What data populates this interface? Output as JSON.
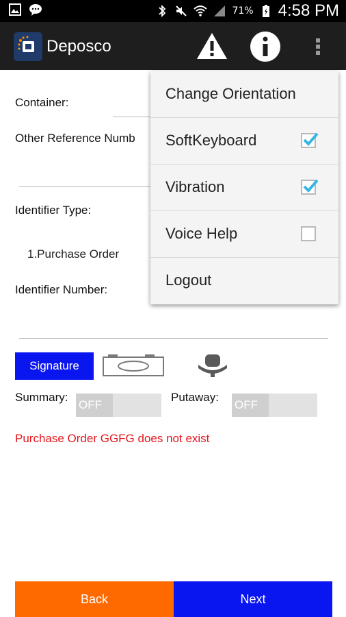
{
  "status_bar": {
    "battery_percent": "71%",
    "time": "4:58 PM",
    "icons": [
      "gallery-icon",
      "chat-icon",
      "bluetooth-icon",
      "mute-icon",
      "wifi-icon",
      "signal-icon",
      "battery-icon"
    ]
  },
  "action_bar": {
    "title": "Deposco",
    "actions": [
      "warning-icon",
      "info-icon",
      "overflow-menu-icon"
    ]
  },
  "form": {
    "container_label": "Container:",
    "other_reference_label": "Other Reference Numb",
    "identifier_type_label": "Identifier Type:",
    "identifier_type_value": "1.Purchase Order",
    "identifier_number_label": "Identifier Number:",
    "signature_button": "Signature",
    "summary_label": "Summary:",
    "summary_toggle": "OFF",
    "putaway_label": "Putaway:",
    "putaway_toggle": "OFF",
    "error_message": "Purchase Order GGFG does not exist"
  },
  "buttons": {
    "back": "Back",
    "next": "Next"
  },
  "overflow_menu": {
    "items": [
      {
        "label": "Change Orientation"
      },
      {
        "label": "SoftKeyboard",
        "checked": true
      },
      {
        "label": "Vibration",
        "checked": true
      },
      {
        "label": "Voice Help",
        "checked": false
      },
      {
        "label": "Logout"
      }
    ]
  },
  "colors": {
    "accent_blue": "#0a16f0",
    "back_orange": "#ff6a00",
    "error_red": "#e4141c",
    "checkbox_blue": "#33b5e5"
  }
}
